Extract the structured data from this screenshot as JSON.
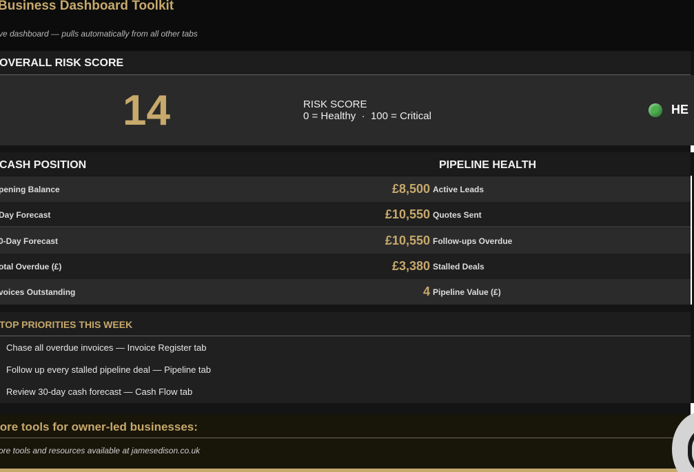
{
  "header": {
    "title": "Business Dashboard Toolkit",
    "subtitle": "ve dashboard — pulls automatically from all other tabs"
  },
  "risk": {
    "heading": "OVERALL RISK SCORE",
    "score": "14",
    "label": "RISK SCORE",
    "scale": "0 = Healthy  ·  100 = Critical",
    "status": "HE",
    "status_color": "#4caf50"
  },
  "cash": {
    "heading": "CASH POSITION",
    "rows": [
      {
        "label": "pening Balance",
        "value": "£8,500"
      },
      {
        "label": "Day Forecast",
        "value": "£10,550"
      },
      {
        "label": "0-Day Forecast",
        "value": "£10,550"
      },
      {
        "label": "otal Overdue (£)",
        "value": "£3,380"
      },
      {
        "label": "voices Outstanding",
        "value": "4"
      }
    ]
  },
  "pipeline": {
    "heading": "PIPELINE HEALTH",
    "rows": [
      {
        "label": "Active Leads"
      },
      {
        "label": "Quotes Sent"
      },
      {
        "label": "Follow-ups Overdue"
      },
      {
        "label": "Stalled Deals"
      },
      {
        "label": "Pipeline Value (£)"
      }
    ]
  },
  "priorities": {
    "heading": "TOP PRIORITIES THIS WEEK",
    "items": [
      "Chase all overdue invoices — Invoice Register tab",
      "Follow up every stalled pipeline deal — Pipeline tab",
      "Review 30-day cash forecast — Cash Flow tab"
    ]
  },
  "tools": {
    "title": "lore tools for owner-led businesses:",
    "subtitle": "ore tools and resources available at jamesedison.co.uk"
  },
  "colors": {
    "accent": "#c7a96c",
    "background": "#141414"
  }
}
